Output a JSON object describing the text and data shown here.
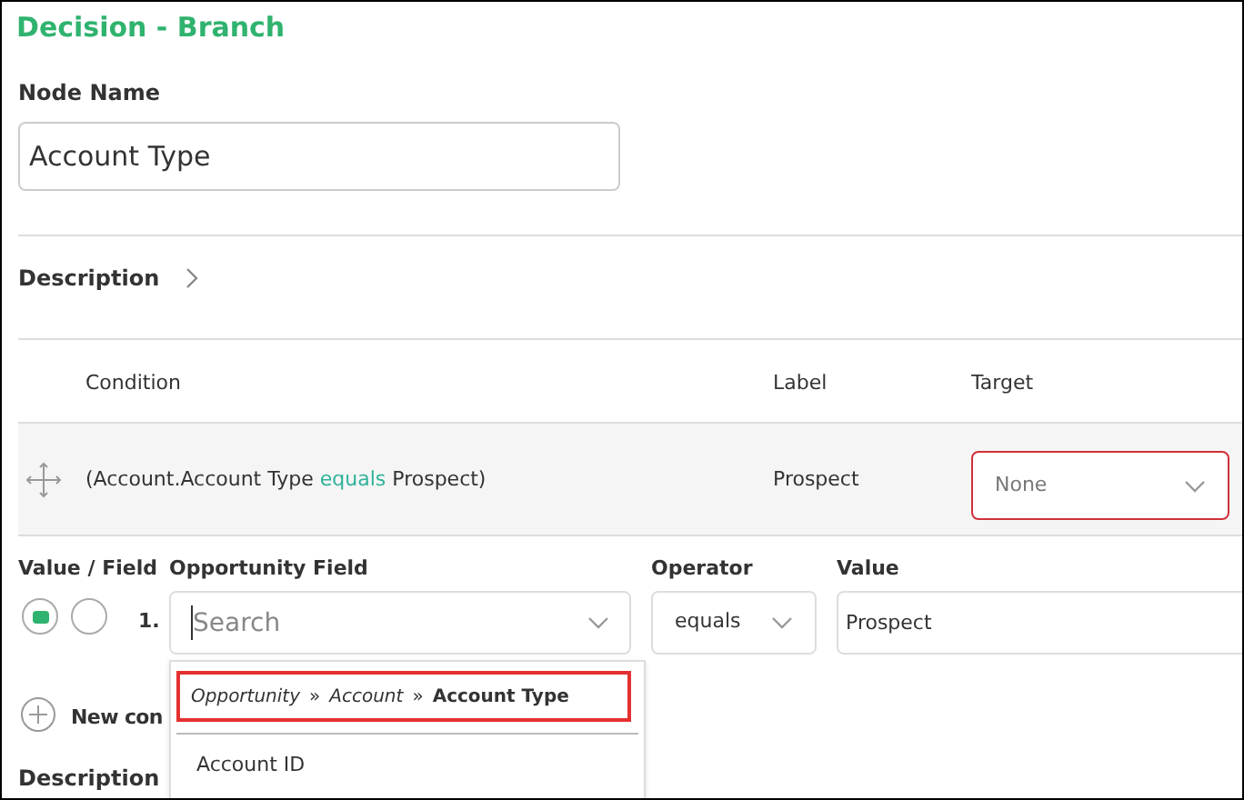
{
  "title": "Decision - Branch",
  "node_name": {
    "label": "Node Name",
    "value": "Account Type"
  },
  "description": {
    "label": "Description"
  },
  "table": {
    "columns": [
      "Condition",
      "Label",
      "Target"
    ],
    "rows": [
      {
        "condition_parts": [
          "(Account.Account Type",
          "equals",
          "Prospect)"
        ],
        "label": "Prospect",
        "target": {
          "placeholder": "None",
          "invalid": true
        }
      }
    ]
  },
  "editor": {
    "headers": [
      "Value / Field",
      "Opportunity Field",
      "Operator",
      "Value"
    ],
    "mode_options": [
      {
        "selected": true
      },
      {
        "selected": false
      }
    ],
    "number": "1.",
    "field": {
      "placeholder": "Search"
    },
    "operator": "equals",
    "value": "Prospect",
    "dropdown": {
      "path": [
        {
          "text": "Opportunity",
          "current": false
        },
        {
          "text": "»",
          "kind": "sep"
        },
        {
          "text": "Account",
          "current": false
        },
        {
          "text": "»",
          "kind": "sep"
        },
        {
          "text": "Account Type",
          "current": true
        }
      ],
      "items": [
        "Account ID"
      ]
    }
  },
  "new_condition": "New con",
  "description_2": {
    "label": "Description"
  }
}
